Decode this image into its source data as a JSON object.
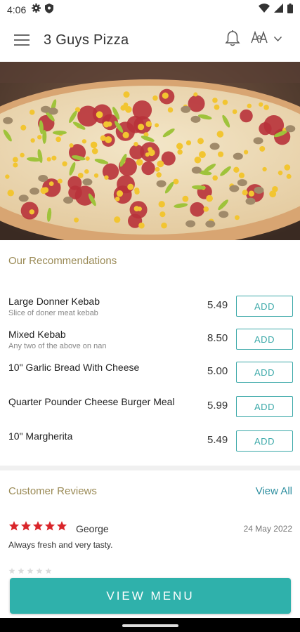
{
  "status_bar": {
    "time": "4:06",
    "icons": [
      "gear-icon",
      "shield-icon",
      "wifi-icon",
      "signal-icon",
      "battery-icon"
    ]
  },
  "app_bar": {
    "title": "3 Guys Pizza",
    "icons": [
      "hamburger-menu-icon",
      "bell-icon",
      "language-icon",
      "chevron-down-icon"
    ]
  },
  "recommendations": {
    "title": "Our Recommendations",
    "add_label": "ADD",
    "items": [
      {
        "name": "Large Donner Kebab",
        "description": "Slice of doner meat kebab",
        "price": "5.49"
      },
      {
        "name": "Mixed Kebab",
        "description": "Any two of the above on nan",
        "price": "8.50"
      },
      {
        "name": "10\" Garlic Bread With Cheese",
        "description": "",
        "price": "5.00"
      },
      {
        "name": "Quarter Pounder Cheese Burger Meal",
        "description": "",
        "price": "5.99"
      },
      {
        "name": "10\" Margherita",
        "description": "",
        "price": "5.49"
      }
    ]
  },
  "reviews": {
    "title": "Customer Reviews",
    "view_all": "View All",
    "items": [
      {
        "rating": 5,
        "author": "George",
        "date": "24 May 2022",
        "text": "Always fresh and very tasty."
      }
    ]
  },
  "cta": {
    "label": "VIEW MENU"
  },
  "colors": {
    "accent": "#2fb1ab",
    "section_title": "#9a8a55",
    "star": "#d9252a",
    "link": "#2f8fa0"
  }
}
